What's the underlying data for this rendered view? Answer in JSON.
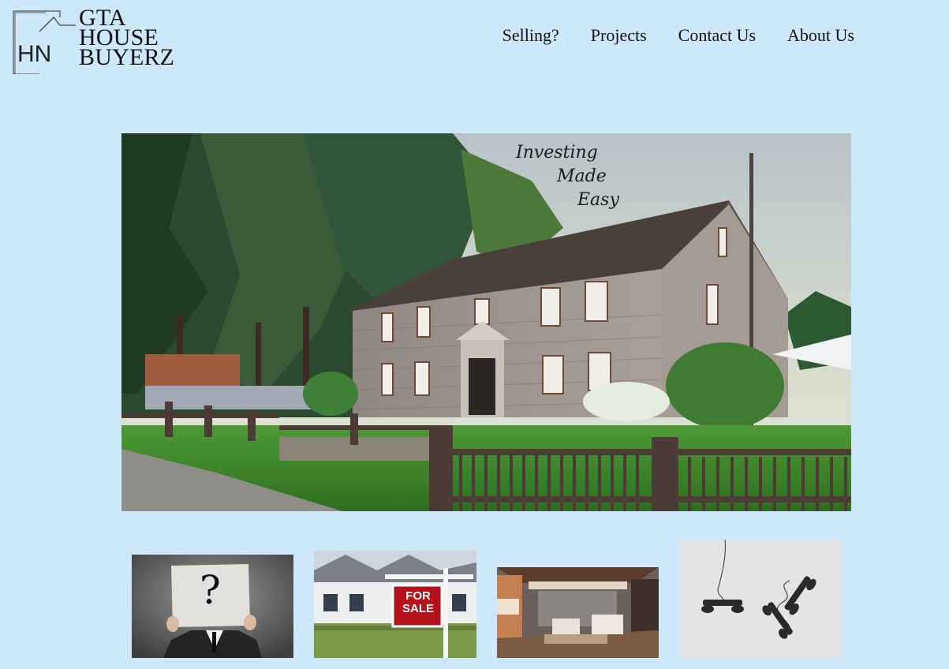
{
  "brand": {
    "logo_initials": "HN",
    "line1": "GTA",
    "line2": "HOUSE",
    "line3": "BUYERZ"
  },
  "nav": {
    "items": [
      "Selling?",
      "Projects",
      "Contact Us",
      "About Us"
    ]
  },
  "hero": {
    "tagline_line1": "Investing",
    "tagline_line2": "Made",
    "tagline_line3": "Easy"
  },
  "thumbnails": {
    "question": {
      "symbol": "?"
    },
    "forsale": {
      "sign_line1": "FOR",
      "sign_line2": "SALE"
    },
    "interior": {},
    "phones": {}
  },
  "colors": {
    "page_background": "#cde8fb",
    "sign_red": "#b3121b"
  }
}
